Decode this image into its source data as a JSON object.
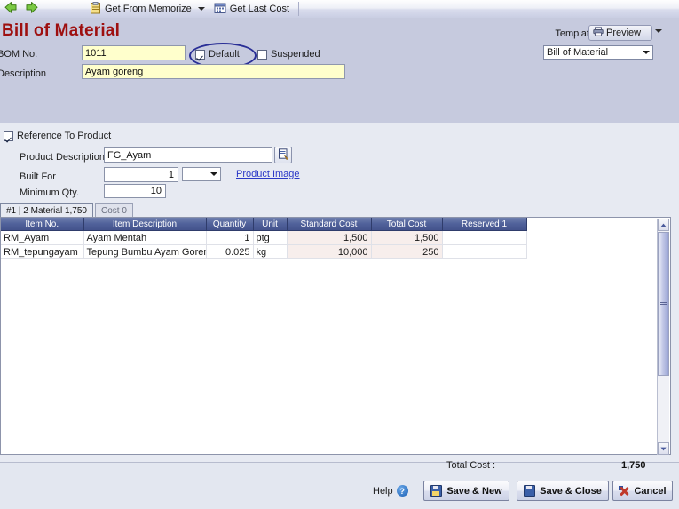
{
  "toolbar": {
    "back_icon": "back-arrow-icon",
    "forward_icon": "forward-arrow-icon",
    "get_from_memorize": "Get From Memorize",
    "get_last_cost": "Get Last Cost"
  },
  "header": {
    "title": "Bill of Material",
    "bom_no_label": "BOM No.",
    "bom_no_value": "1011",
    "description_label": "Description",
    "description_value": "Ayam goreng",
    "default_label": "Default",
    "default_checked": true,
    "suspended_label": "Suspended",
    "suspended_checked": false,
    "template_label": "Template",
    "preview_label": "Preview",
    "template_value": "Bill of Material"
  },
  "reference": {
    "ref_to_product_label": "Reference To Product",
    "ref_to_product_checked": true,
    "product_description_label": "Product Description",
    "product_description_value": "FG_Ayam",
    "built_for_label": "Built For",
    "built_for_value": "1",
    "built_for_unit": "",
    "minimum_qty_label": "Minimum Qty.",
    "minimum_qty_value": "10",
    "product_image_link": "Product Image"
  },
  "tabs": [
    {
      "label": "#1 | 2 Material   1,750",
      "active": true
    },
    {
      "label": "Cost   0",
      "active": false
    }
  ],
  "grid": {
    "columns": [
      "Item No.",
      "Item Description",
      "Quantity",
      "Unit",
      "Standard Cost",
      "Total Cost",
      "Reserved 1"
    ],
    "rows": [
      {
        "item_no": "RM_Ayam",
        "item_description": "Ayam Mentah",
        "quantity": "1",
        "unit": "ptg",
        "standard_cost": "1,500",
        "total_cost": "1,500",
        "reserved_1": ""
      },
      {
        "item_no": "RM_tepungayam",
        "item_description": "Tepung Bumbu Ayam Goreng",
        "quantity": "0.025",
        "unit": "kg",
        "standard_cost": "10,000",
        "total_cost": "250",
        "reserved_1": ""
      }
    ]
  },
  "footer": {
    "total_cost_label": "Total Cost :",
    "total_cost_value": "1,750",
    "help_label": "Help",
    "save_new_label": "Save & New",
    "save_close_label": "Save & Close",
    "cancel_label": "Cancel"
  },
  "colors": {
    "title": "#9e1010",
    "header_band": "#c6cade",
    "body": "#e7eaf2",
    "field_yellow": "#ffffcc",
    "grid_header": "#50619a",
    "annotation": "#2a2f96",
    "link": "#2b38c7"
  }
}
